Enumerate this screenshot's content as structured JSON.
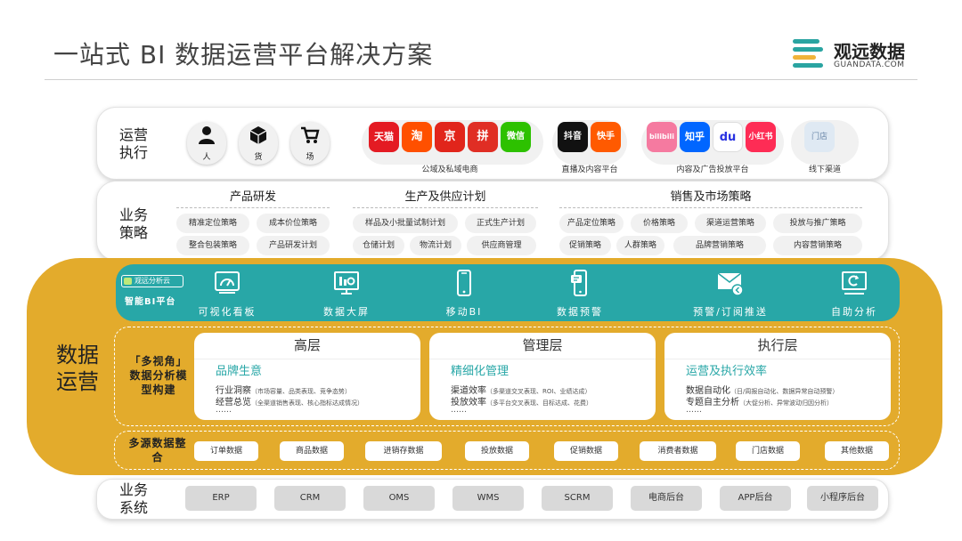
{
  "title": "一站式 BI 数据运营平台解决方案",
  "logo": {
    "name": "观远数据",
    "sub": "GUANDATA.COM"
  },
  "colors": {
    "teal": "#28a7a7",
    "gold": "#e3ab2c"
  },
  "ops_exec": {
    "label": "运营执行",
    "entities": [
      {
        "icon": "person-icon",
        "label": "人"
      },
      {
        "icon": "cube-icon",
        "label": "货"
      },
      {
        "icon": "cart-icon",
        "label": "场"
      }
    ],
    "channels": [
      {
        "caption": "公域及私域电商",
        "apps": [
          "天猫",
          "淘",
          "京",
          "拼",
          "微信"
        ]
      },
      {
        "caption": "直播及内容平台",
        "apps": [
          "抖音",
          "快手"
        ]
      },
      {
        "caption": "内容及广告投放平台",
        "apps": [
          "bilibili",
          "知乎",
          "du",
          "小红书"
        ]
      },
      {
        "caption": "线下渠道",
        "apps": [
          "门店"
        ]
      }
    ]
  },
  "biz_strategy": {
    "label": "业务策略",
    "groups": [
      {
        "title": "产品研发",
        "items": [
          "精准定位策略",
          "成本价位策略",
          "整合包装策略",
          "产品研发计划"
        ]
      },
      {
        "title": "生产及供应计划",
        "items": [
          "样品及小批量试制计划",
          "正式生产计划",
          "仓储计划",
          "物流计划",
          "供应商管理"
        ]
      },
      {
        "title": "销售及市场策略",
        "items": [
          "产品定位策略",
          "价格策略",
          "渠道运营策略",
          "投放与推广策略",
          "促销策略",
          "人群策略",
          "品牌营销策略",
          "内容营销策略"
        ]
      }
    ]
  },
  "data_ops": {
    "label": "数据运营",
    "bi_platform": {
      "badge": "观远分析云",
      "sub": "智能BI平台"
    },
    "tools": [
      {
        "icon": "gauge-icon",
        "label": "可视化看板"
      },
      {
        "icon": "screen-icon",
        "label": "数据大屏"
      },
      {
        "icon": "mobile-icon",
        "label": "移动BI"
      },
      {
        "icon": "alert-phone-icon",
        "label": "数据预警"
      },
      {
        "icon": "mail-icon",
        "label": "预警/订阅推送"
      },
      {
        "icon": "auto-analysis-icon",
        "label": "自助分析"
      }
    ],
    "multi_view_label": "「多视角」数据分析模型构建",
    "levels": [
      {
        "title": "高层",
        "subtitle": "品牌生意",
        "lines": [
          {
            "main": "行业洞察",
            "note": "（市场容量、品类表现、竞争态势）"
          },
          {
            "main": "经营总览",
            "note": "（全渠道销售表现、核心指标达成情况）"
          }
        ],
        "more": "……"
      },
      {
        "title": "管理层",
        "subtitle": "精细化管理",
        "lines": [
          {
            "main": "渠道效率",
            "note": "（多渠道交叉表现、ROI、业绩达成）"
          },
          {
            "main": "投放效率",
            "note": "（多平台交叉表现、目标达成、花费）"
          }
        ],
        "more": "……"
      },
      {
        "title": "执行层",
        "subtitle": "运营及执行效率",
        "lines": [
          {
            "main": "数据自动化",
            "note": "（日/周报自动化、数据异常自动预警）"
          },
          {
            "main": "专题自主分析",
            "note": "（大促分析、异常波动归因分析）"
          }
        ],
        "more": "……"
      }
    ],
    "source_label": "多源数据整合",
    "sources": [
      "订单数据",
      "商品数据",
      "进销存数据",
      "投放数据",
      "促销数据",
      "消费者数据",
      "门店数据",
      "其他数据"
    ]
  },
  "biz_systems": {
    "label": "业务系统",
    "items": [
      "ERP",
      "CRM",
      "OMS",
      "WMS",
      "SCRM",
      "电商后台",
      "APP后台",
      "小程序后台"
    ]
  }
}
